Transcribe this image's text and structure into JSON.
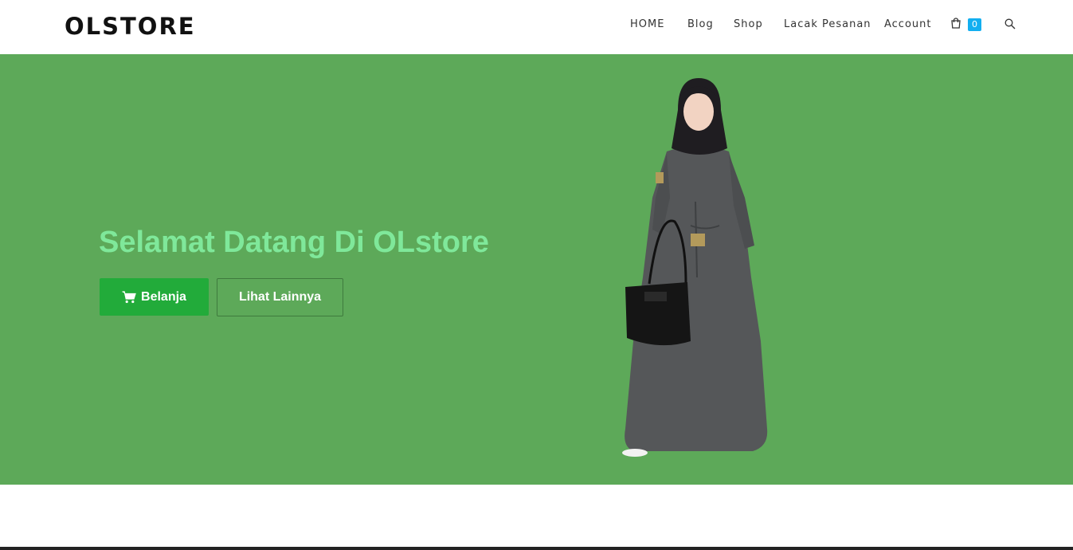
{
  "brand": {
    "logo": "OLSTORE"
  },
  "nav": {
    "items": [
      {
        "label": "HOME"
      },
      {
        "label": "Blog"
      },
      {
        "label": "Shop"
      },
      {
        "label": "Lacak Pesanan"
      },
      {
        "label": "Account"
      }
    ],
    "cart": {
      "icon": "shopping-bag-icon",
      "count": "0",
      "badge_color": "#13aff0"
    },
    "search": {
      "icon": "search-icon"
    }
  },
  "hero": {
    "title": "Selamat Datang Di OLstore",
    "background": "#5da959",
    "title_color": "#7fe89a",
    "buttons": {
      "shop_label": "Belanja",
      "shop_icon": "cart-icon",
      "shop_color": "#22ab3a",
      "more_label": "Lihat Lainnya"
    }
  }
}
